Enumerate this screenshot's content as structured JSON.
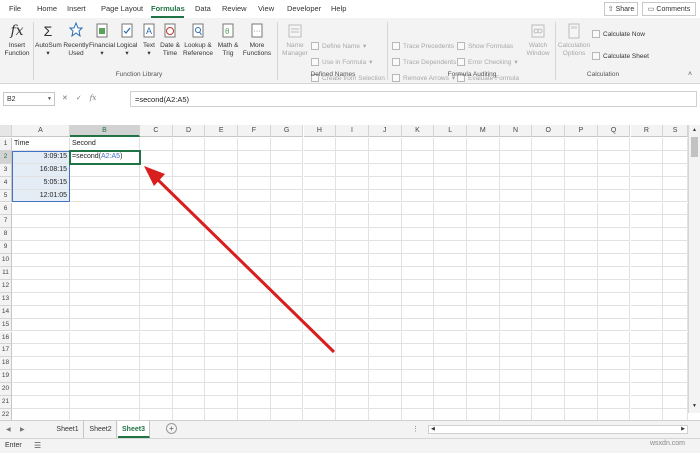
{
  "menu": {
    "items": [
      "File",
      "Home",
      "Insert",
      "Page Layout",
      "Formulas",
      "Data",
      "Review",
      "View",
      "Developer",
      "Help"
    ],
    "active": "Formulas",
    "share_label": "Share",
    "comments_label": "Comments"
  },
  "ribbon": {
    "function_library": {
      "label": "Function Library",
      "insert_function": [
        "Insert",
        "Function"
      ],
      "autosum": "AutoSum",
      "recently_used": [
        "Recently",
        "Used"
      ],
      "financial": "Financial",
      "logical": "Logical",
      "text": "Text",
      "date_time": [
        "Date &",
        "Time"
      ],
      "lookup": [
        "Lookup &",
        "Reference"
      ],
      "math": [
        "Math &",
        "Trig"
      ],
      "more": [
        "More",
        "Functions"
      ]
    },
    "defined_names": {
      "label": "Defined Names",
      "name_manager": [
        "Name",
        "Manager"
      ],
      "define_name": "Define Name",
      "use_in_formula": "Use in Formula",
      "create_from_selection": "Create from Selection"
    },
    "formula_auditing": {
      "label": "Formula Auditing",
      "trace_precedents": "Trace Precedents",
      "trace_dependents": "Trace Dependents",
      "remove_arrows": "Remove Arrows",
      "show_formulas": "Show Formulas",
      "error_checking": "Error Checking",
      "evaluate_formula": "Evaluate Formula",
      "watch_window": [
        "Watch",
        "Window"
      ]
    },
    "calculation": {
      "label": "Calculation",
      "options": [
        "Calculation",
        "Options"
      ],
      "calculate_now": "Calculate Now",
      "calculate_sheet": "Calculate Sheet"
    }
  },
  "formula_bar": {
    "name_box": "B2",
    "cancel": "✕",
    "enter": "✓",
    "fx": "fx",
    "formula": "=second(A2:A5)"
  },
  "sheet": {
    "columns": [
      "A",
      "B",
      "C",
      "D",
      "E",
      "F",
      "G",
      "H",
      "I",
      "J",
      "K",
      "L",
      "M",
      "N",
      "O",
      "P",
      "Q",
      "R",
      "S"
    ],
    "rows": [
      "1",
      "2",
      "3",
      "4",
      "5",
      "6",
      "7",
      "8",
      "9",
      "10",
      "11",
      "12",
      "13",
      "14",
      "15",
      "16",
      "17",
      "18",
      "19",
      "20",
      "21",
      "22"
    ],
    "header_a1": "Time",
    "header_b1": "Second",
    "times": [
      "3:09:15",
      "16:08:15",
      "5:05:15",
      "12:01:05"
    ],
    "edit_prefix": "=second(",
    "edit_ref": "A2:A5",
    "edit_suffix": ")"
  },
  "tabs": {
    "items": [
      "Sheet1",
      "Sheet2",
      "Sheet3"
    ],
    "active": "Sheet3",
    "add": "+"
  },
  "status": {
    "mode": "Enter"
  },
  "watermark": "wsxdn.com",
  "colors": {
    "accent": "#217346",
    "range": "#4472c4",
    "arrow": "#d81e1e"
  }
}
